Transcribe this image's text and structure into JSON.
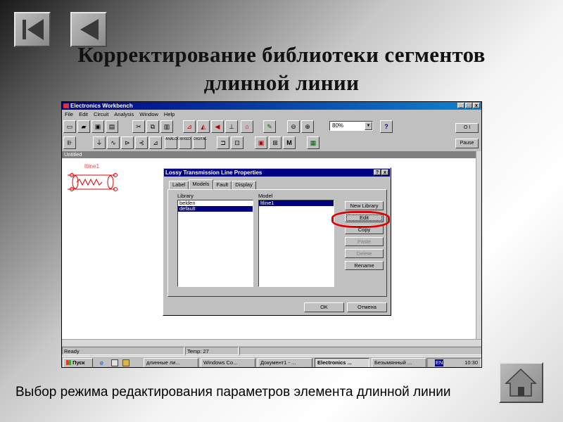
{
  "slide": {
    "title_line1": "Корректирование  библиотеки сегментов",
    "title_line2": "длинной линии",
    "caption": "Выбор режима редактирования параметров элемента длинной  линии"
  },
  "app": {
    "title": "Electronics Workbench",
    "menu": [
      "File",
      "Edit",
      "Circuit",
      "Analysis",
      "Window",
      "Help"
    ],
    "zoom": "80%",
    "pause_label": "Pause",
    "power_switch_label": "O I",
    "doc_title": "Untitled",
    "component_label": "ltline1",
    "toolbar2_labels": [
      "ANALOG",
      "MIXED",
      "DIGITAL"
    ],
    "status": {
      "left": "Ready",
      "temp": "Temp:  27"
    }
  },
  "dialog": {
    "title": "Lossy Transmission Line Properties",
    "tabs": [
      "Label",
      "Models",
      "Fault",
      "Display"
    ],
    "active_tab": "Models",
    "library_label": "Library",
    "library_items": [
      "belden",
      "default"
    ],
    "library_selected": "default",
    "model_label": "Model",
    "model_items": [
      "ltline1"
    ],
    "buttons": {
      "new_library": "New Library",
      "edit": "Edit",
      "copy": "Copy",
      "paste": "Paste",
      "delete": "Delete",
      "rename": "Rename"
    },
    "ok": "OK",
    "cancel": "Отмена"
  },
  "taskbar": {
    "start": "Пуск",
    "tasks": [
      "длинные ли...",
      "Windows Co...",
      "Документ1 - ...",
      "Electronics ...",
      "Безымянный ..."
    ],
    "active_task": "Electronics ...",
    "tray_lang": "EN",
    "clock": "10:30"
  },
  "colors": {
    "titlebar": "#000080",
    "highlight_circle": "#e00000",
    "component": "#e00000"
  }
}
